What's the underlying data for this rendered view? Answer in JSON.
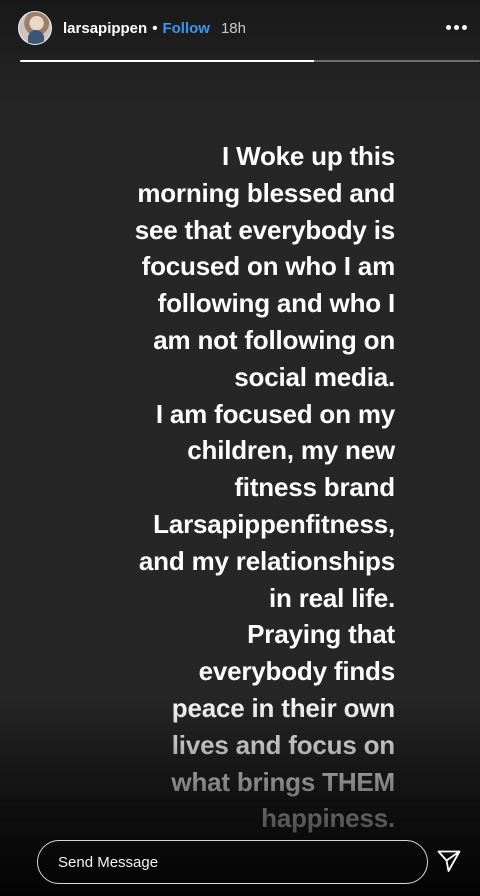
{
  "header": {
    "username": "larsapippen",
    "separator": "•",
    "follow_label": "Follow",
    "time_ago": "18h",
    "more_icon": "more-horizontal-icon"
  },
  "progress": {
    "fraction": 0.64
  },
  "story": {
    "lines": [
      "I Woke up this",
      "morning blessed and",
      "see that everybody is",
      "focused on who I am",
      "following and who I",
      "am not following on",
      "social media.",
      "I am focused on my",
      "children, my new",
      "fitness brand",
      "Larsapippenfitness,",
      "and my relationships",
      "in real life.",
      "Praying that",
      "everybody finds",
      "peace in their own",
      "lives and focus on",
      "what brings THEM",
      "happiness."
    ],
    "text_color": "#ffffff",
    "background_color": "#262626"
  },
  "footer": {
    "message_placeholder": "Send Message",
    "send_icon": "paper-plane-icon"
  },
  "colors": {
    "accent": "#3897f0"
  }
}
